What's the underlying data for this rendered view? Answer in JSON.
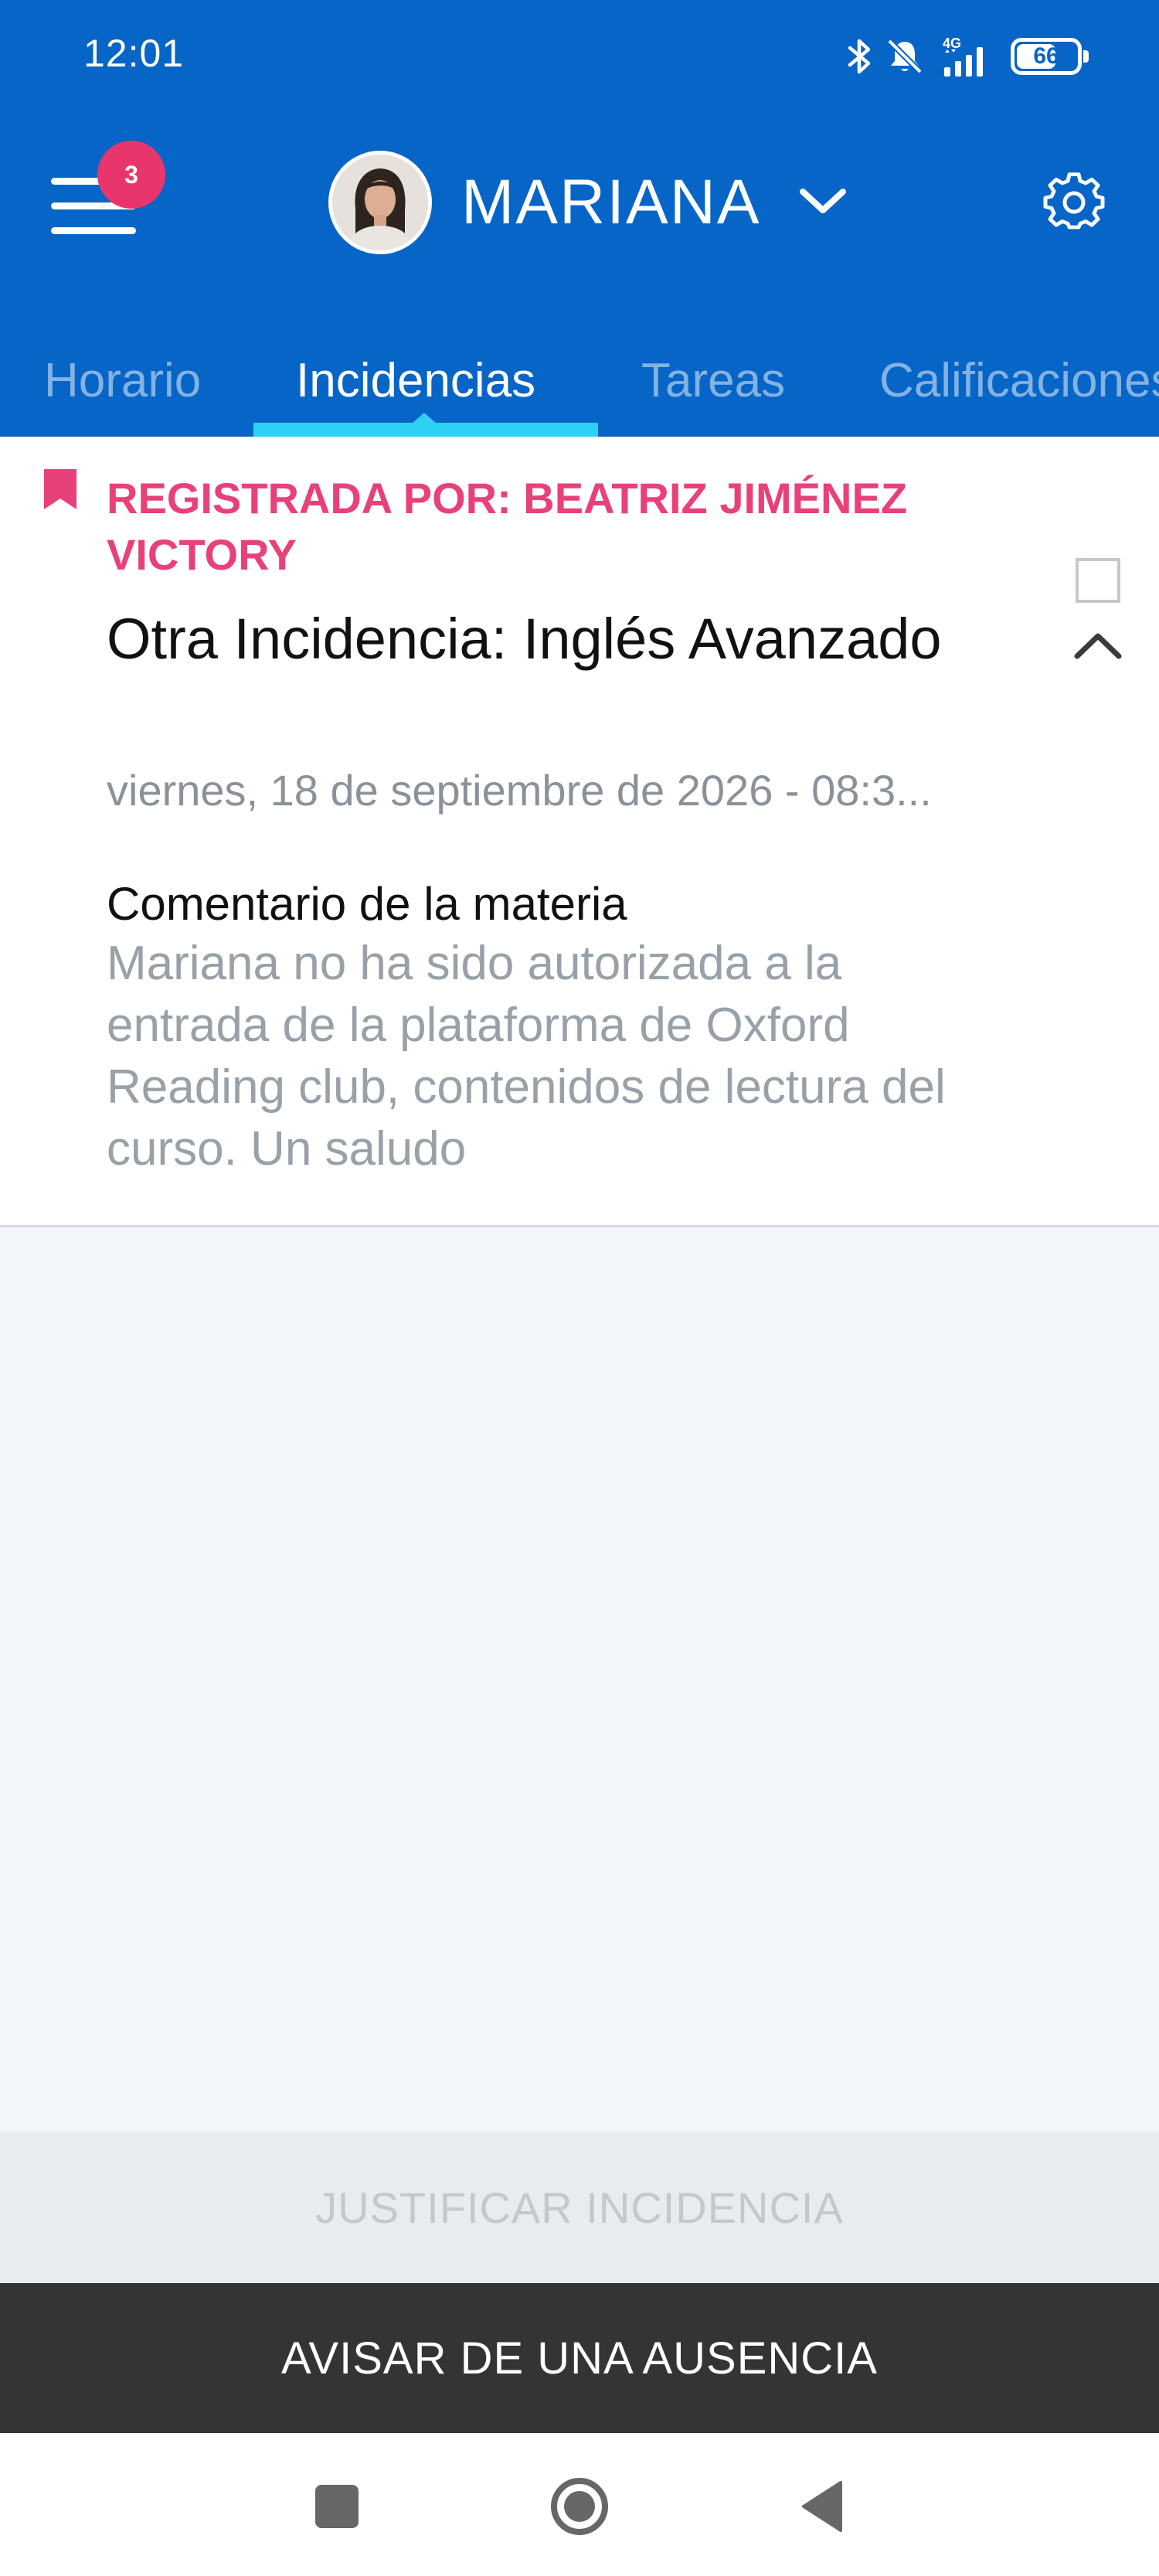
{
  "status_bar": {
    "time": "12:01",
    "network": "4G",
    "battery": "66",
    "battery_level": 0.66,
    "icons": [
      "bluetooth-icon",
      "bell-muted-icon",
      "signal-icon",
      "battery-icon"
    ]
  },
  "app_bar": {
    "notification_count": "3",
    "student_name": "MARIANA",
    "icons": [
      "menu-icon",
      "avatar",
      "chevron-down-icon",
      "gear-icon"
    ]
  },
  "tabs": [
    {
      "label": "Horario",
      "active": false
    },
    {
      "label": "Incidencias",
      "active": true
    },
    {
      "label": "Tareas",
      "active": false
    },
    {
      "label": "Calificaciones",
      "active": false
    }
  ],
  "incident": {
    "registered_by": "REGISTRADA POR: BEATRIZ JIMÉNEZ VICTORY",
    "title": "Otra Incidencia: Inglés Avanzado",
    "date": "viernes, 18 de septiembre de 2026 - 08:3...",
    "comment_label": "Comentario de la materia",
    "comment": "Mariana no ha sido autorizada a la entrada de la plataforma de Oxford Reading club, contenidos de lectura del curso. Un saludo",
    "icons": [
      "bookmark-icon",
      "checkbox",
      "chevron-up-icon"
    ]
  },
  "actions": {
    "justify_label": "JUSTIFICAR INCIDENCIA",
    "justify_enabled": false,
    "notify_label": "AVISAR DE UNA AUSENCIA"
  },
  "colors": {
    "header_blue": "#0665c6",
    "accent_pink": "#e8417a",
    "tab_indicator": "#2ed0f4",
    "dark_button": "#343434"
  }
}
